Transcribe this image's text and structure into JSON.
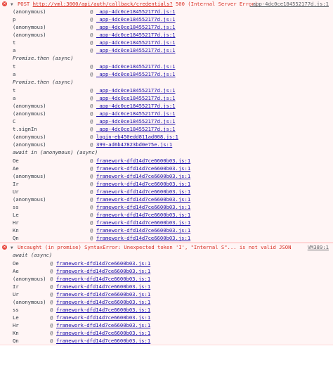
{
  "error1": {
    "method": "POST",
    "url": "http://vml:3000/api/auth/callback/credentials?",
    "status": "500 (Internal Server Error)",
    "source": "_app-4dc0ce184552177d.js:1",
    "stack": [
      {
        "fn": "(anonymous)",
        "loc": "_app-4dc0ce184552177d.js:1"
      },
      {
        "fn": "p",
        "loc": "_app-4dc0ce184552177d.js:1"
      },
      {
        "fn": "(anonymous)",
        "loc": "_app-4dc0ce184552177d.js:1"
      },
      {
        "fn": "(anonymous)",
        "loc": "_app-4dc0ce184552177d.js:1"
      },
      {
        "fn": "t",
        "loc": "_app-4dc0ce184552177d.js:1"
      },
      {
        "fn": "a",
        "loc": "_app-4dc0ce184552177d.js:1"
      },
      {
        "async": "Promise.then (async)"
      },
      {
        "fn": "t",
        "loc": "_app-4dc0ce184552177d.js:1"
      },
      {
        "fn": "a",
        "loc": "_app-4dc0ce184552177d.js:1"
      },
      {
        "async": "Promise.then (async)"
      },
      {
        "fn": "t",
        "loc": "_app-4dc0ce184552177d.js:1"
      },
      {
        "fn": "a",
        "loc": "_app-4dc0ce184552177d.js:1"
      },
      {
        "fn": "(anonymous)",
        "loc": "_app-4dc0ce184552177d.js:1"
      },
      {
        "fn": "(anonymous)",
        "loc": "_app-4dc0ce184552177d.js:1"
      },
      {
        "fn": "C",
        "loc": "_app-4dc0ce184552177d.js:1"
      },
      {
        "fn": "t.signIn",
        "loc": "_app-4dc0ce184552177d.js:1"
      },
      {
        "fn": "(anonymous)",
        "loc": "login-eb450edd811ad008.js:1"
      },
      {
        "fn": "(anonymous)",
        "loc": "399-ad6b47823bd0e75e.js:1"
      },
      {
        "async": "await in (anonymous) (async)"
      },
      {
        "fn": "Oe",
        "loc": "framework-dfd14d7ce6600b03.js:1"
      },
      {
        "fn": "Ae",
        "loc": "framework-dfd14d7ce6600b03.js:1"
      },
      {
        "fn": "(anonymous)",
        "loc": "framework-dfd14d7ce6600b03.js:1"
      },
      {
        "fn": "Ir",
        "loc": "framework-dfd14d7ce6600b03.js:1"
      },
      {
        "fn": "Ur",
        "loc": "framework-dfd14d7ce6600b03.js:1"
      },
      {
        "fn": "(anonymous)",
        "loc": "framework-dfd14d7ce6600b03.js:1"
      },
      {
        "fn": "ss",
        "loc": "framework-dfd14d7ce6600b03.js:1"
      },
      {
        "fn": "Le",
        "loc": "framework-dfd14d7ce6600b03.js:1"
      },
      {
        "fn": "Hr",
        "loc": "framework-dfd14d7ce6600b03.js:1"
      },
      {
        "fn": "Kn",
        "loc": "framework-dfd14d7ce6600b03.js:1"
      },
      {
        "fn": "Qn",
        "loc": "framework-dfd14d7ce6600b03.js:1"
      }
    ]
  },
  "error2": {
    "message": "Uncaught (in promise) SyntaxError: Unexpected token 'I', \"Internal S\"... is not valid JSON",
    "source": "VM389:1",
    "stack": [
      {
        "async": "await (async)"
      },
      {
        "fn": "Oe",
        "loc": "framework-dfd14d7ce6600b03.js:1"
      },
      {
        "fn": "Ae",
        "loc": "framework-dfd14d7ce6600b03.js:1"
      },
      {
        "fn": "(anonymous)",
        "loc": "framework-dfd14d7ce6600b03.js:1"
      },
      {
        "fn": "Ir",
        "loc": "framework-dfd14d7ce6600b03.js:1"
      },
      {
        "fn": "Ur",
        "loc": "framework-dfd14d7ce6600b03.js:1"
      },
      {
        "fn": "(anonymous)",
        "loc": "framework-dfd14d7ce6600b03.js:1"
      },
      {
        "fn": "ss",
        "loc": "framework-dfd14d7ce6600b03.js:1"
      },
      {
        "fn": "Le",
        "loc": "framework-dfd14d7ce6600b03.js:1"
      },
      {
        "fn": "Hr",
        "loc": "framework-dfd14d7ce6600b03.js:1"
      },
      {
        "fn": "Kn",
        "loc": "framework-dfd14d7ce6600b03.js:1"
      },
      {
        "fn": "Qn",
        "loc": "framework-dfd14d7ce6600b03.js:1"
      }
    ]
  },
  "ui": {
    "error_icon": "error-x-icon",
    "expand_icon": "triangle-down-icon",
    "at_symbol": "@",
    "error_color": "#d93025",
    "link_color": "#1a0dab",
    "error_bg": "#fff5f5"
  }
}
